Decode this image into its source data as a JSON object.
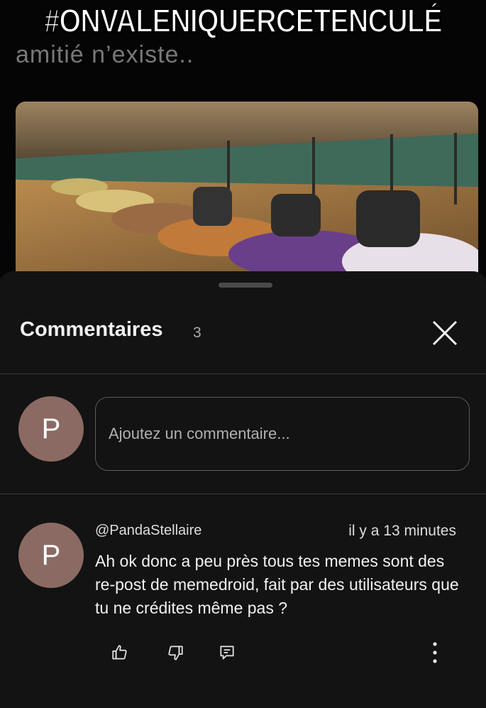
{
  "overlay": {
    "title": "#ONVALENIQUERCETENCULÉ"
  },
  "post": {
    "faded_text": "amitié n’existe.."
  },
  "comments_sheet": {
    "title": "Commentaires",
    "count": "3",
    "composer": {
      "avatar_initial": "P",
      "placeholder": "Ajoutez un commentaire..."
    }
  },
  "comment": {
    "avatar_initial": "P",
    "author": "@PandaStellaire",
    "time": "il y a 13 minutes",
    "text": "Ah ok donc a peu près tous tes memes sont des re-post de memedroid, fait par des utilisateurs que tu ne crédites même pas ?"
  },
  "icons": {
    "close": "close-icon",
    "like": "thumbs-up-icon",
    "dislike": "thumbs-down-icon",
    "reply": "reply-icon",
    "more": "more-vertical-icon"
  },
  "colors": {
    "sheet_bg": "#131313",
    "avatar_bg": "#8b6a63",
    "text": "#f1f1f1"
  }
}
